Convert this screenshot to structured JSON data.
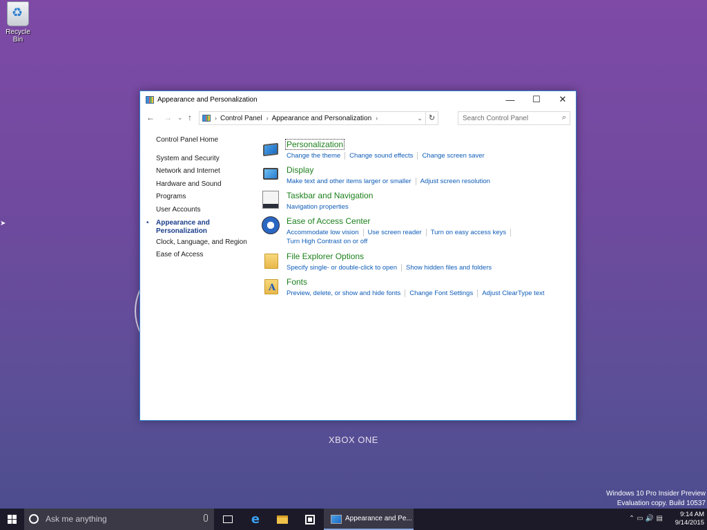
{
  "desktop": {
    "recycle_bin_label": "Recycle Bin",
    "console_label": "XBOX ONE",
    "watermark": {
      "line1": "Windows 10 Pro Insider Preview",
      "line2": "Evaluation copy. Build 10537"
    }
  },
  "window": {
    "title": "Appearance and Personalization",
    "controls": {
      "minimize": "—",
      "maximize": "☐",
      "close": "✕"
    },
    "nav": {
      "back": "←",
      "forward": "→",
      "recent": "⌄",
      "up": "↑"
    },
    "address": {
      "breadcrumbs": [
        "Control Panel",
        "Appearance and Personalization"
      ],
      "separator": "›",
      "dropdown": "⌄",
      "refresh": "↻"
    },
    "search": {
      "placeholder": "Search Control Panel"
    },
    "sidebar": {
      "home": "Control Panel Home",
      "items": [
        {
          "label": "System and Security"
        },
        {
          "label": "Network and Internet"
        },
        {
          "label": "Hardware and Sound"
        },
        {
          "label": "Programs"
        },
        {
          "label": "User Accounts"
        },
        {
          "label": "Appearance and Personalization",
          "active": true
        },
        {
          "label": "Clock, Language, and Region"
        },
        {
          "label": "Ease of Access"
        }
      ]
    },
    "categories": [
      {
        "icon": "personalization-icon",
        "title": "Personalization",
        "links": [
          "Change the theme",
          "Change sound effects",
          "Change screen saver"
        ]
      },
      {
        "icon": "display-icon",
        "title": "Display",
        "links": [
          "Make text and other items larger or smaller",
          "Adjust screen resolution"
        ]
      },
      {
        "icon": "taskbar-icon",
        "title": "Taskbar and Navigation",
        "links": [
          "Navigation properties"
        ]
      },
      {
        "icon": "ease-of-access-icon",
        "title": "Ease of Access Center",
        "links": [
          "Accommodate low vision",
          "Use screen reader",
          "Turn on easy access keys"
        ],
        "links2": [
          "Turn High Contrast on or off"
        ]
      },
      {
        "icon": "folder-options-icon",
        "title": "File Explorer Options",
        "links": [
          "Specify single- or double-click to open",
          "Show hidden files and folders"
        ]
      },
      {
        "icon": "fonts-icon",
        "title": "Fonts",
        "links": [
          "Preview, delete, or show and hide fonts",
          "Change Font Settings",
          "Adjust ClearType text"
        ]
      }
    ]
  },
  "taskbar": {
    "search_placeholder": "Ask me anything",
    "active_app_label": "Appearance and Pe...",
    "clock": {
      "time": "9:14 AM",
      "date": "9/14/2015"
    }
  }
}
